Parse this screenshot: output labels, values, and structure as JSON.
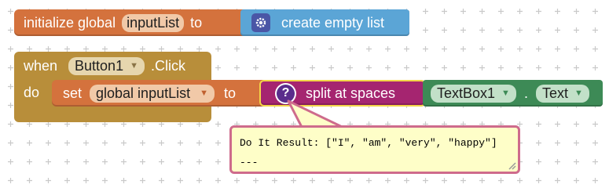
{
  "colors": {
    "variables": "#d4723d",
    "lists": "#5ba5d6",
    "events": "#b88e3a",
    "text": "#a52570",
    "components": "#3d8a56",
    "comment": "#fefec8"
  },
  "init_block": {
    "prefix": "initialize global",
    "variable_name": "inputList",
    "suffix": "to",
    "value_block": {
      "icon": "gear-icon",
      "label": "create empty list"
    }
  },
  "event_block": {
    "when_label": "when",
    "component": "Button1",
    "event": ".Click",
    "do_label": "do"
  },
  "set_block": {
    "prefix": "set",
    "variable": "global inputList",
    "suffix": "to"
  },
  "split_block": {
    "icon": "question-icon",
    "label": "split at spaces"
  },
  "textbox_block": {
    "component": "TextBox1",
    "dot": ".",
    "property": "Text"
  },
  "result_bubble": {
    "line1": "Do It Result: [\"I\", \"am\", \"very\", \"happy\"]",
    "line2": "---"
  }
}
